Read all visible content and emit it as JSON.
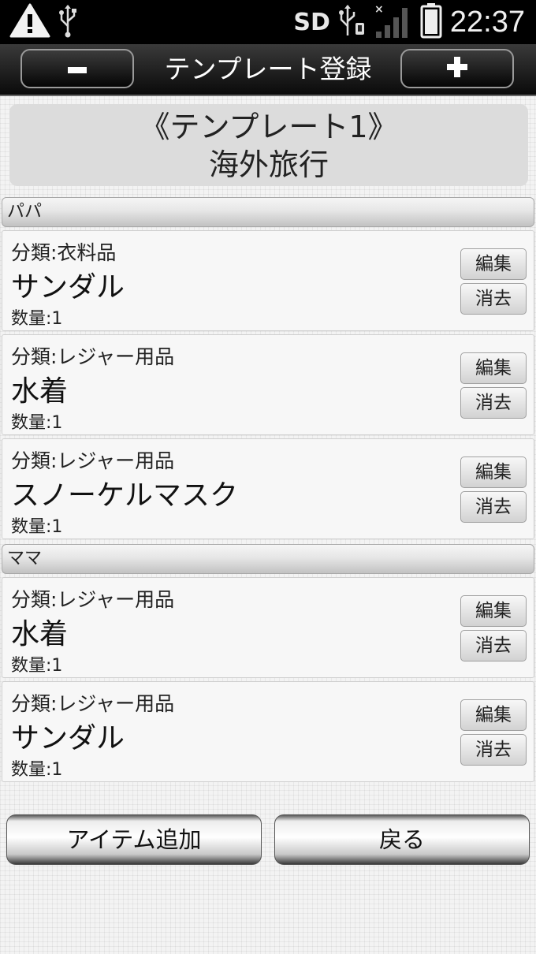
{
  "status_bar": {
    "icons_left": [
      "warning-icon",
      "usb-icon"
    ],
    "sd_label": "SD",
    "icons_right": [
      "usb-icon",
      "sdcard-icon",
      "no-signal-icon",
      "battery-icon"
    ],
    "time": "22:37"
  },
  "title_bar": {
    "title": "テンプレート登録",
    "minus_label": "−",
    "plus_label": "+"
  },
  "header": {
    "template_label": "《テンプレート1》",
    "template_name": "海外旅行"
  },
  "groups": [
    {
      "name": "パパ",
      "items": [
        {
          "category": "分類:衣料品",
          "name": "サンダル",
          "quantity": "数量:1"
        },
        {
          "category": "分類:レジャー用品",
          "name": "水着",
          "quantity": "数量:1"
        },
        {
          "category": "分類:レジャー用品",
          "name": "スノーケルマスク",
          "quantity": "数量:1"
        }
      ]
    },
    {
      "name": "ママ",
      "items": [
        {
          "category": "分類:レジャー用品",
          "name": "水着",
          "quantity": "数量:1"
        },
        {
          "category": "分類:レジャー用品",
          "name": "サンダル",
          "quantity": "数量:1"
        }
      ]
    }
  ],
  "item_buttons": {
    "edit": "編集",
    "delete": "消去"
  },
  "bottom": {
    "add_item": "アイテム追加",
    "back": "戻る"
  }
}
